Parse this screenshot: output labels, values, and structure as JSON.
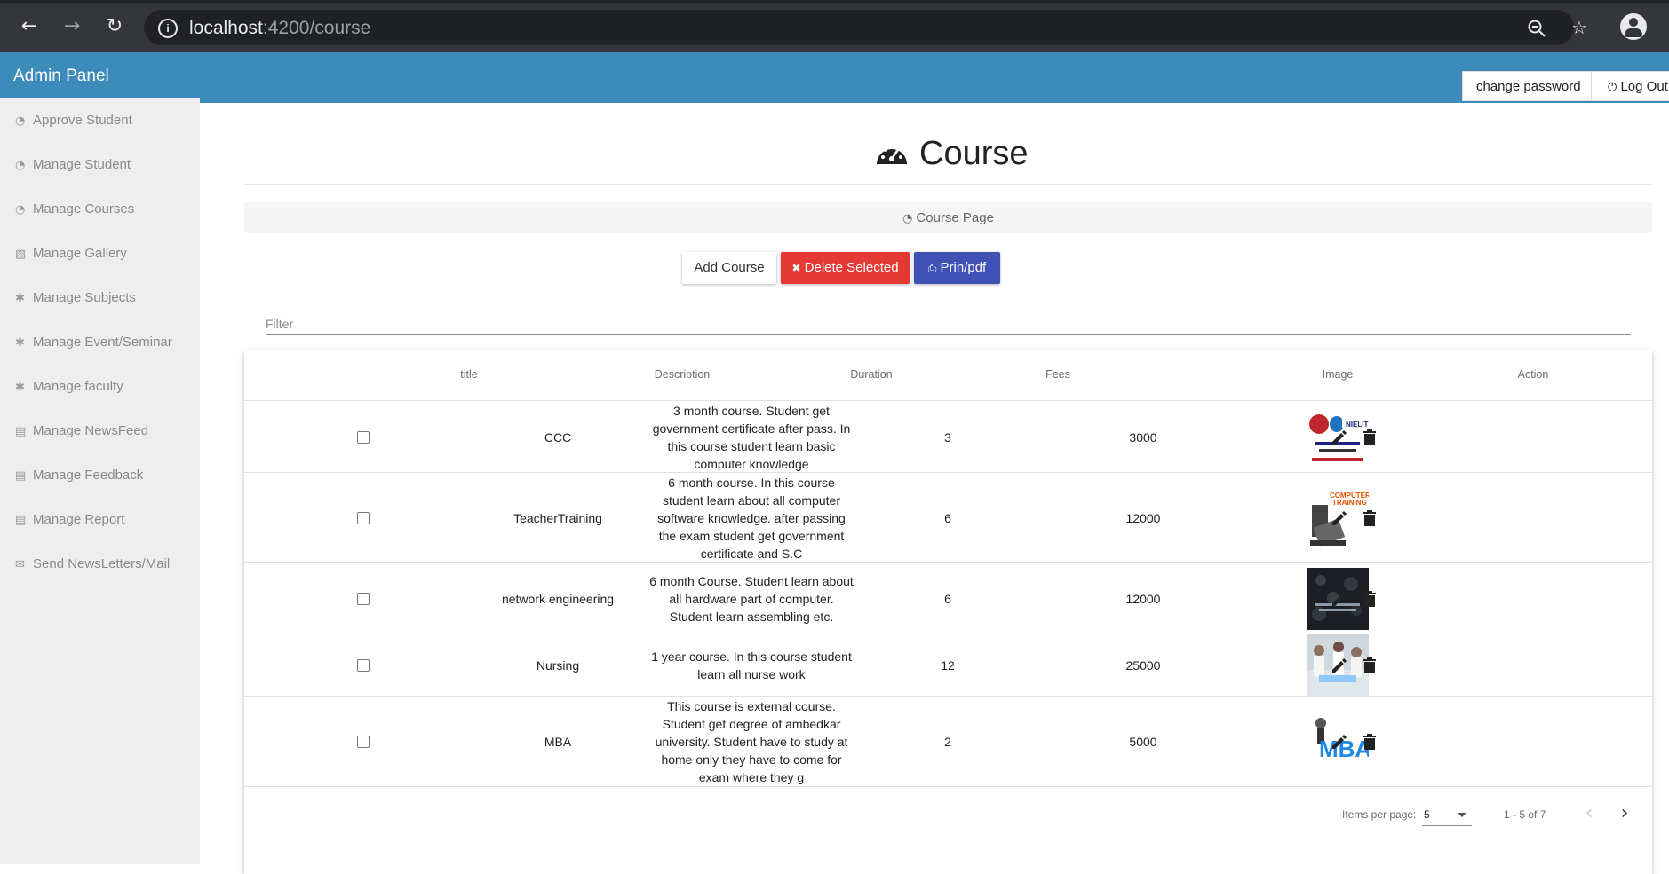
{
  "browser": {
    "url_host": "localhost",
    "url_path": ":4200/course"
  },
  "app": {
    "brand": "Admin Panel",
    "change_password": "change password",
    "logout": "Log Out"
  },
  "sidebar": {
    "items": [
      {
        "label": "Approve Student",
        "icon": "dashboard-icon"
      },
      {
        "label": "Manage Student",
        "icon": "dashboard-icon"
      },
      {
        "label": "Manage Courses",
        "icon": "dashboard-icon"
      },
      {
        "label": "Manage Gallery",
        "icon": "picture-icon"
      },
      {
        "label": "Manage Subjects",
        "icon": "gear-icon"
      },
      {
        "label": "Manage Event/Seminar",
        "icon": "gear-icon"
      },
      {
        "label": "Manage faculty",
        "icon": "gear-icon"
      },
      {
        "label": "Manage NewsFeed",
        "icon": "list-icon"
      },
      {
        "label": "Manage Feedback",
        "icon": "list-icon"
      },
      {
        "label": "Manage Report",
        "icon": "list-icon"
      },
      {
        "label": "Send NewsLetters/Mail",
        "icon": "envelope-icon"
      }
    ]
  },
  "main": {
    "title": "Course",
    "breadcrumb": "Course Page",
    "add_button": "Add Course",
    "delete_button": "Delete Selected",
    "print_button": "Prin/pdf",
    "filter_placeholder": "Filter"
  },
  "table": {
    "headers": {
      "title": "title",
      "description": "Description",
      "duration": "Duration",
      "fees": "Fees",
      "image": "Image",
      "action": "Action"
    },
    "rows": [
      {
        "title": "CCC",
        "description": "3 month course. Student get government certificate after pass. In this course student learn basic computer knowledge",
        "duration": "3",
        "fees": "3000",
        "image": "ccc-nielit-logo"
      },
      {
        "title": "TeacherTraining",
        "description": "6 month course. In this course student learn about all computer software knowledge. after passing the exam student get government certificate and S.C",
        "duration": "6",
        "fees": "12000",
        "image": "computer-training-image"
      },
      {
        "title": "network engineering",
        "description": "6 month Course. Student learn about all hardware part of computer. Student learn assembling etc.",
        "duration": "6",
        "fees": "12000",
        "image": "network-engineering-image"
      },
      {
        "title": "Nursing",
        "description": "1 year course. In this course student learn all nurse work",
        "duration": "12",
        "fees": "25000",
        "image": "nursing-photo"
      },
      {
        "title": "MBA",
        "description": "This course is external course. Student get degree of ambedkar university. Student have to study at home only they have to come for exam where they g",
        "duration": "2",
        "fees": "5000",
        "image": "mba-image"
      }
    ]
  },
  "paginator": {
    "items_label": "Items per page:",
    "page_size": "5",
    "range": "1 - 5 of 7"
  }
}
